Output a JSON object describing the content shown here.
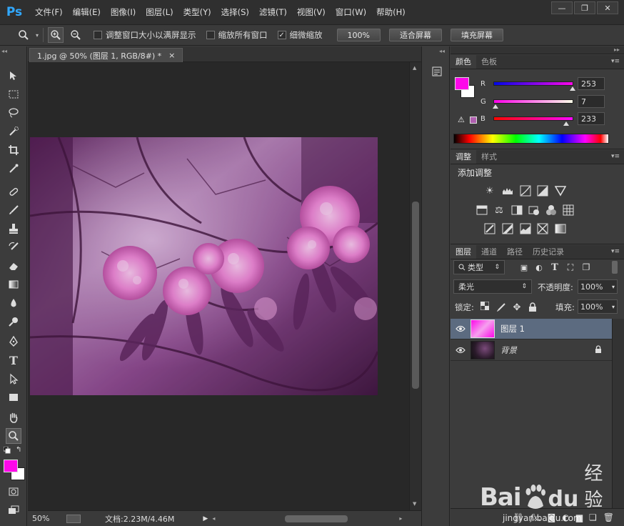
{
  "app": {
    "logo": "Ps",
    "menu": [
      "文件(F)",
      "编辑(E)",
      "图像(I)",
      "图层(L)",
      "类型(Y)",
      "选择(S)",
      "滤镜(T)",
      "视图(V)",
      "窗口(W)",
      "帮助(H)"
    ],
    "window_controls": [
      "—",
      "❐",
      "✕"
    ]
  },
  "options_bar": {
    "resize_windows_label": "调整窗口大小以满屏显示",
    "resize_windows_checked": false,
    "zoom_all_label": "缩放所有窗口",
    "zoom_all_checked": false,
    "scrubby_label": "细微缩放",
    "scrubby_checked": true,
    "btn_100": "100%",
    "btn_fit": "适合屏幕",
    "btn_fill": "填充屏幕"
  },
  "document": {
    "tab_title": "1.jpg @ 50% (图层 1, RGB/8#) *",
    "tab_close": "×",
    "status_zoom": "50%",
    "status_doc": "文档:2.23M/4.46M"
  },
  "color_panel": {
    "tabs": [
      "颜色",
      "色板"
    ],
    "foreground": "#fd07e9",
    "R_label": "R",
    "R_value": "253",
    "R_fraction": 0.992,
    "G_label": "G",
    "G_value": "7",
    "G_fraction": 0.027,
    "B_label": "B",
    "B_value": "233",
    "B_fraction": 0.914
  },
  "adjust_panel": {
    "tabs": [
      "调整",
      "样式"
    ],
    "title": "添加调整"
  },
  "layers_panel": {
    "tabs": [
      "图层",
      "通道",
      "路径",
      "历史记录"
    ],
    "filter_kind": "类型",
    "blend_mode": "柔光",
    "opacity_label": "不透明度:",
    "opacity_value": "100%",
    "lock_label": "锁定:",
    "fill_label": "填充:",
    "fill_value": "100%",
    "layers": [
      {
        "name": "图层 1",
        "selected": true,
        "locked": false
      },
      {
        "name": "背景",
        "selected": false,
        "locked": true
      }
    ],
    "footer_fx": "fx."
  },
  "watermark": {
    "brand": "Bai",
    "brand2": "du",
    "cn": "经验",
    "url": "jingyan.baidu.com"
  }
}
